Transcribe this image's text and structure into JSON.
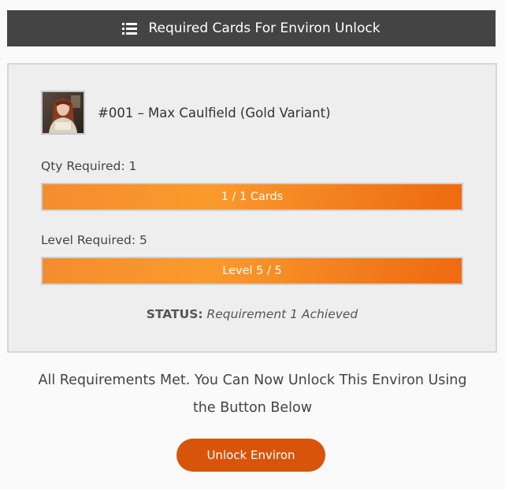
{
  "header": {
    "title": "Required Cards For Environ Unlock",
    "icon": "list-icon"
  },
  "card": {
    "image_icon": "card-thumbnail",
    "title": "#001 – Max Caulfield (Gold Variant)"
  },
  "quantity": {
    "label": "Qty Required: 1",
    "progress_text": "1 / 1 Cards",
    "progress_value": 1.0
  },
  "level": {
    "label": "Level Required: 5",
    "progress_text": "Level 5 / 5",
    "progress_value": 1.0
  },
  "status": {
    "key": "STATUS:",
    "value": "Requirement 1 Achieved"
  },
  "message": {
    "line1": "All Requirements Met. You Can Now Unlock This Environ Using",
    "line2": "the Button Below"
  },
  "unlock_button": {
    "label": "Unlock Environ"
  },
  "colors": {
    "header_bg": "#444444",
    "progress_fill": "#f48c2e",
    "button_bg": "#d8540a"
  }
}
